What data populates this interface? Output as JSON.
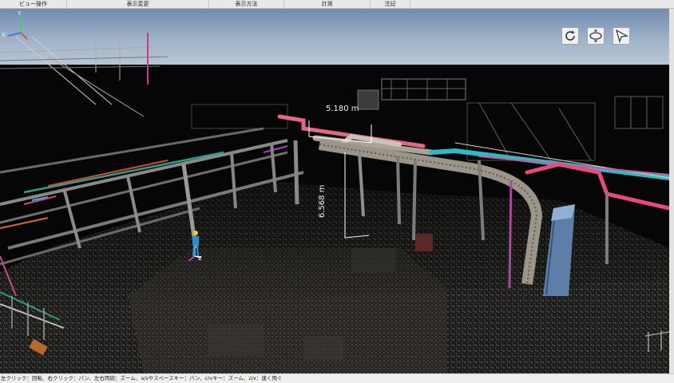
{
  "menubar": {
    "items": [
      {
        "label": "ビュー操作"
      },
      {
        "label": "表示変更"
      },
      {
        "label": "表示方法"
      },
      {
        "label": "計測"
      },
      {
        "label": "注記"
      }
    ]
  },
  "viewport": {
    "scene": "3D point cloud of an industrial pipe rack",
    "measurements": {
      "horizontal": "5.180 m",
      "vertical": "6.568 m"
    },
    "axis_labels": {
      "x": "X",
      "y": "Y",
      "z": "Z"
    },
    "tools": [
      {
        "icon": "rotate-icon"
      },
      {
        "icon": "pan-icon"
      },
      {
        "icon": "navigate-arrow-icon"
      }
    ]
  },
  "status": {
    "text": "左クリック：回転、右クリック：パン、左右両続：ズーム、a/sやスペースキー：パン、c/vキー：ズーム、z/x：速く飛ぐ"
  }
}
